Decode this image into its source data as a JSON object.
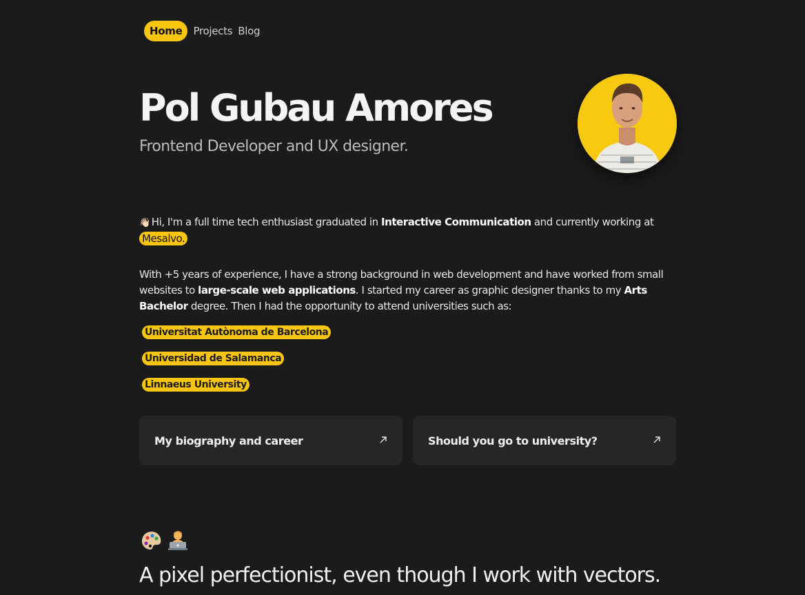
{
  "nav": {
    "items": [
      {
        "label": "Home",
        "active": true
      },
      {
        "label": "Projects",
        "active": false
      },
      {
        "label": "Blog",
        "active": false
      }
    ]
  },
  "hero": {
    "name": "Pol Gubau Amores",
    "subtitle": "Frontend Developer and UX designer."
  },
  "intro": {
    "wave_emoji": "👋🏻",
    "p1_a": "Hi, I'm a full time tech enthusiast graduated in ",
    "p1_b": "Interactive Communication",
    "p1_c": " and currently working at ",
    "company": "Mesalvo.",
    "p2_a": "With +5 years of experience, I have a strong background in web development and have worked from small websites to ",
    "p2_b": "large-scale web applications",
    "p2_c": ". I started my career as graphic designer thanks to my ",
    "p2_d": "Arts Bachelor",
    "p2_e": " degree. Then I had the opportunity to attend universities such as:"
  },
  "universities": [
    "Universitat Autònoma de Barcelona",
    "Universidad de Salamanca",
    "Linnaeus University"
  ],
  "cards": [
    {
      "label": "My biography and career",
      "icon": "arrow-up-right-icon"
    },
    {
      "label": "Should you go to university?",
      "icon": "arrow-up-right-icon"
    }
  ],
  "bottom": {
    "emojis": [
      "palette-icon",
      "technologist-icon"
    ],
    "tagline": "A pixel perfectionist, even though I work with vectors."
  },
  "colors": {
    "background": "#1b1b1b",
    "accent": "#f9c50f",
    "card": "#262626"
  }
}
